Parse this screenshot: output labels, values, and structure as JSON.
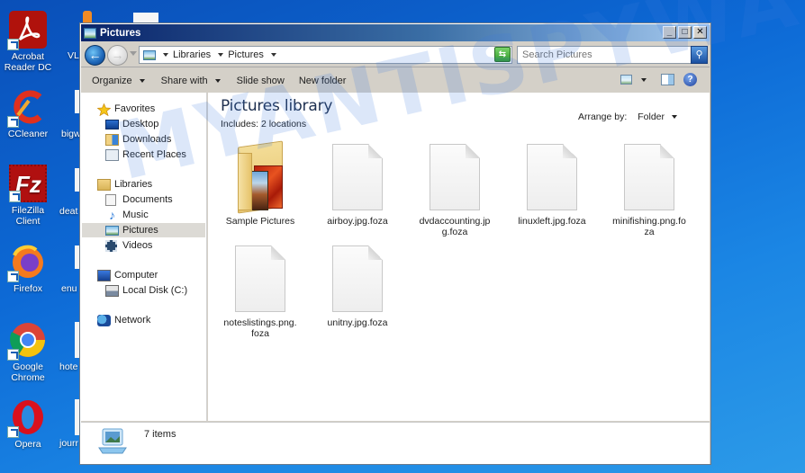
{
  "desktop": {
    "icons": [
      {
        "name": "acrobat",
        "label": "Acrobat Reader DC"
      },
      {
        "name": "ccleaner",
        "label": "CCleaner"
      },
      {
        "name": "filezilla",
        "label": "FileZilla Client"
      },
      {
        "name": "firefox",
        "label": "Firefox"
      },
      {
        "name": "chrome",
        "label": "Google Chrome"
      },
      {
        "name": "opera",
        "label": "Opera"
      }
    ],
    "partial_labels": [
      "VL",
      "bigw",
      "deat",
      "enu",
      "hote",
      "jourr"
    ]
  },
  "window": {
    "title": "Pictures",
    "controls": {
      "minimize": "_",
      "maximize": "□",
      "close": "✕"
    }
  },
  "navbar": {
    "breadcrumbs": [
      "Libraries",
      "Pictures"
    ],
    "search_placeholder": "Search Pictures",
    "back_icon": "←"
  },
  "commandbar": {
    "items": [
      {
        "label": "Organize",
        "dropdown": true
      },
      {
        "label": "Share with",
        "dropdown": true
      },
      {
        "label": "Slide show",
        "dropdown": false
      },
      {
        "label": "New folder",
        "dropdown": false
      }
    ],
    "help_icon": "?"
  },
  "navpane": {
    "favorites": {
      "label": "Favorites",
      "items": [
        "Desktop",
        "Downloads",
        "Recent Places"
      ]
    },
    "libraries": {
      "label": "Libraries",
      "items": [
        "Documents",
        "Music",
        "Pictures",
        "Videos"
      ],
      "selected": "Pictures"
    },
    "computer": {
      "label": "Computer",
      "items": [
        "Local Disk (C:)"
      ]
    },
    "network": {
      "label": "Network"
    }
  },
  "content": {
    "title": "Pictures library",
    "subtitle": "Includes:  2 locations",
    "arrange_label": "Arrange by:",
    "arrange_value": "Folder",
    "files": [
      {
        "name": "Sample Pictures",
        "type": "folder"
      },
      {
        "name": "airboy.jpg.foza",
        "type": "file"
      },
      {
        "name": "dvdaccounting.jpg.foza",
        "type": "file"
      },
      {
        "name": "linuxleft.jpg.foza",
        "type": "file"
      },
      {
        "name": "minifishing.png.foza",
        "type": "file"
      },
      {
        "name": "noteslistings.png.foza",
        "type": "file"
      },
      {
        "name": "unitny.jpg.foza",
        "type": "file"
      }
    ]
  },
  "statusbar": {
    "text": "7 items"
  },
  "watermark": "MYANTISPYWARE.COM"
}
